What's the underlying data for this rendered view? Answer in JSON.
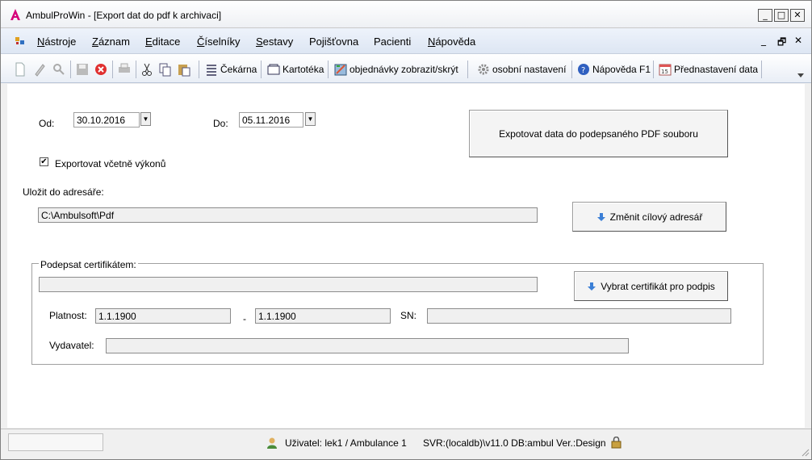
{
  "window": {
    "app_name": "AmbulProWin",
    "title": "AmbulProWin  - [Export dat do pdf  k archivaci]",
    "minimize": "_",
    "maximize": "□",
    "close": "✕"
  },
  "menu": {
    "items": [
      "Nástroje",
      "Záznam",
      "Editace",
      "Číselníky",
      "Sestavy",
      "Pojišťovna",
      "Pacienti",
      "Nápověda"
    ],
    "mdi_min": "_",
    "mdi_restore": "🗗",
    "mdi_close": "✕"
  },
  "toolbar": {
    "cekarna": "Čekárna",
    "kartoteka": "Kartotéka",
    "objednavky": "objednávky zobrazit/skrýt",
    "nastaveni": "osobní nastavení",
    "napoveda": "Nápověda F1",
    "prednastaveni": "Přednastavení data"
  },
  "form": {
    "od_label": "Od:",
    "od_value": "30.10.2016",
    "do_label": "Do:",
    "do_value": "05.11.2016",
    "export_button": "Expotovat data do podepsaného PDF souboru",
    "include_label": "Exportovat včetně výkonů",
    "include_checked": "✔",
    "dir_label": "Uložit do adresáře:",
    "dir_value": "C:\\Ambulsoft\\Pdf",
    "change_dir_button": "Změnit cílový adresář",
    "cert_group_label": "Podepsat certifikátem:",
    "cert_value": "",
    "select_cert_button": "Vybrat certifikát pro podpis",
    "platnost_label": "Platnost:",
    "platnost_from": "1.1.1900",
    "platnost_dash": "-",
    "platnost_to": "1.1.1900",
    "sn_label": "SN:",
    "sn_value": "",
    "vydavatel_label": "Vydavatel:",
    "vydavatel_value": ""
  },
  "status": {
    "user": "Uživatel: lek1 / Ambulance 1",
    "server": "SVR:(localdb)\\v11.0 DB:ambul Ver.:Design"
  },
  "colors": {
    "accent": "#d6007a",
    "arrow_blue": "#3b7fd6"
  }
}
